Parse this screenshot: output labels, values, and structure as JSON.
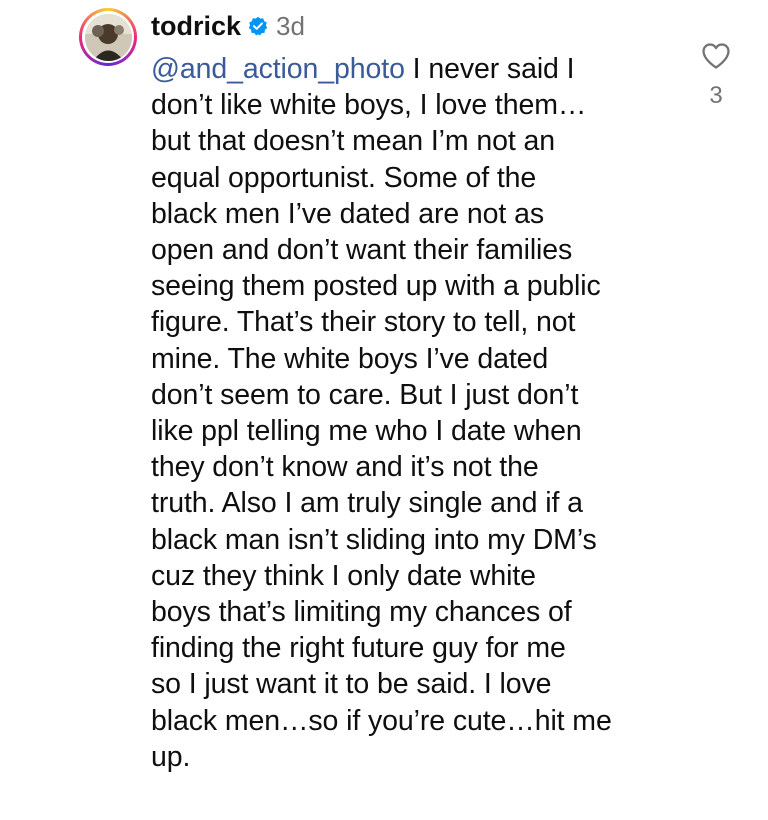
{
  "comment": {
    "username": "todrick",
    "timestamp": "3d",
    "mention": "@and_action_photo",
    "lines": [
      " I never said I",
      "don’t like white boys, I love them…",
      "but that doesn’t mean I’m not an",
      "equal opportunist. Some of the",
      "black men I’ve dated are not as",
      "open and don’t want their families",
      "seeing them posted up with a public",
      "figure. That’s their story to tell, not",
      "mine. The white boys I’ve dated",
      "don’t seem to care. But I just don’t",
      "like ppl telling me who I date when",
      "they don’t know and it’s not the",
      "truth. Also I am truly single and if a",
      "black man isn’t sliding into my DM’s",
      "cuz they think I only date white",
      "boys that’s limiting my chances of",
      "finding the right future guy for me",
      "so I just want it to be said. I love",
      "black men…so if you’re cute…hit me",
      "up."
    ],
    "like_count": "3"
  },
  "icons": {
    "verified": "verified-badge-icon",
    "like": "heart-outline-icon"
  },
  "colors": {
    "mention": "#3a5a9a",
    "verified_badge": "#0095f6",
    "muted": "#737373"
  }
}
